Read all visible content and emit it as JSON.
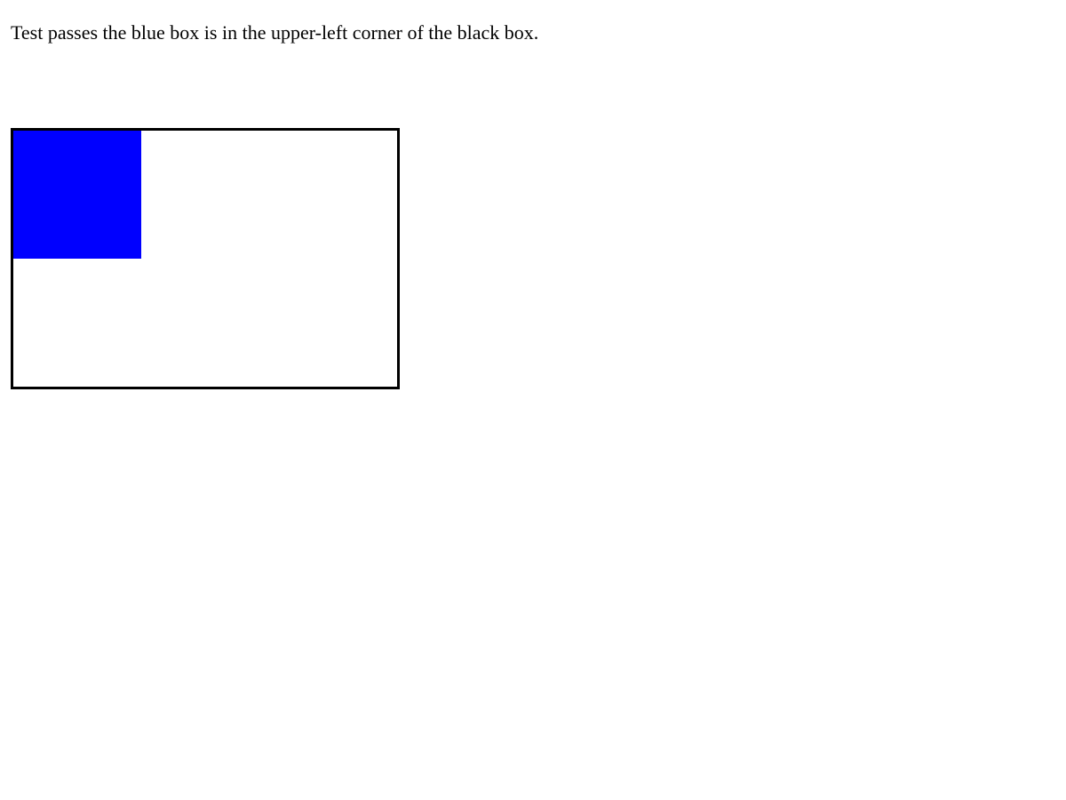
{
  "instruction_text": "Test passes the blue box is in the upper-left corner of the black box.",
  "colors": {
    "outer_box_border": "#000000",
    "inner_box_fill": "#0000ff",
    "background": "#ffffff"
  }
}
